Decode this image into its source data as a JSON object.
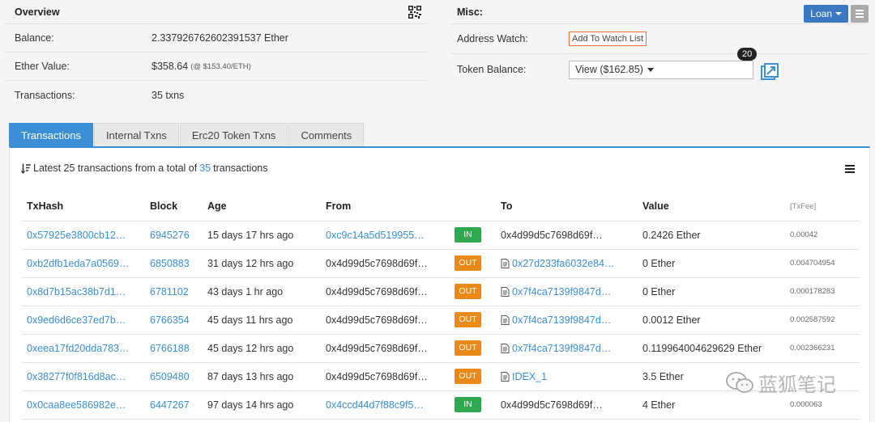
{
  "overview": {
    "title": "Overview",
    "rows": [
      {
        "label": "Balance:",
        "value": "2.337926762602391537 Ether",
        "sub": ""
      },
      {
        "label": "Ether Value:",
        "value": "$358.64",
        "sub": "(@ $153.40/ETH)"
      },
      {
        "label": "Transactions:",
        "value": "35 txns",
        "sub": ""
      }
    ]
  },
  "misc": {
    "title": "Misc:",
    "loan_label": "Loan",
    "address_watch_label": "Address Watch:",
    "watch_button": "Add To Watch List",
    "token_balance_label": "Token Balance:",
    "token_select_value": "View ($162.85)",
    "token_count_badge": "20"
  },
  "tabs": [
    {
      "label": "Transactions",
      "active": true
    },
    {
      "label": "Internal Txns",
      "active": false
    },
    {
      "label": "Erc20 Token Txns",
      "active": false
    },
    {
      "label": "Comments",
      "active": false
    }
  ],
  "summary": {
    "prefix": "Latest 25 transactions from a total of",
    "count": "35",
    "suffix": "transactions"
  },
  "table": {
    "headers": [
      "TxHash",
      "Block",
      "Age",
      "From",
      "",
      "To",
      "Value",
      "[TxFee]"
    ],
    "rows": [
      {
        "hash": "0x57925e3800cb12…",
        "block": "6945276",
        "age": "15 days 17 hrs ago",
        "from": "0xc9c14a5d519955…",
        "from_link": true,
        "dir": "IN",
        "to": "0x4d99d5c7698d69f…",
        "to_link": false,
        "to_contract": false,
        "value": "0.2426 Ether",
        "fee": "0.00042"
      },
      {
        "hash": "0xb2dfb1eda7a0569…",
        "block": "6850883",
        "age": "31 days 12 hrs ago",
        "from": "0x4d99d5c7698d69f…",
        "from_link": false,
        "dir": "OUT",
        "to": "0x27d233fa6032e84…",
        "to_link": true,
        "to_contract": true,
        "value": "0 Ether",
        "fee": "0.004704954"
      },
      {
        "hash": "0x8d7b15ac38b7d1…",
        "block": "6781102",
        "age": "43 days 1 hr ago",
        "from": "0x4d99d5c7698d69f…",
        "from_link": false,
        "dir": "OUT",
        "to": "0x7f4ca7139f9847d…",
        "to_link": true,
        "to_contract": true,
        "value": "0 Ether",
        "fee": "0.000178283"
      },
      {
        "hash": "0x9ed6d6ce37ed7b…",
        "block": "6766354",
        "age": "45 days 11 hrs ago",
        "from": "0x4d99d5c7698d69f…",
        "from_link": false,
        "dir": "OUT",
        "to": "0x7f4ca7139f9847d…",
        "to_link": true,
        "to_contract": true,
        "value": "0.0012 Ether",
        "fee": "0.002587592"
      },
      {
        "hash": "0xeea17fd20dda783…",
        "block": "6766188",
        "age": "45 days 12 hrs ago",
        "from": "0x4d99d5c7698d69f…",
        "from_link": false,
        "dir": "OUT",
        "to": "0x7f4ca7139f9847d…",
        "to_link": true,
        "to_contract": true,
        "value": "0.119964004629629 Ether",
        "fee": "0.002366231"
      },
      {
        "hash": "0x38277f0f816d8ac…",
        "block": "6509480",
        "age": "87 days 13 hrs ago",
        "from": "0x4d99d5c7698d69f…",
        "from_link": false,
        "dir": "OUT",
        "to": "IDEX_1",
        "to_link": true,
        "to_contract": true,
        "value": "3.5 Ether",
        "fee": ""
      },
      {
        "hash": "0x0caa8ee586982e…",
        "block": "6447267",
        "age": "97 days 14 hrs ago",
        "from": "0x4ccd44d7f88c9f5…",
        "from_link": true,
        "dir": "IN",
        "to": "0x4d99d5c7698d69f…",
        "to_link": false,
        "to_contract": false,
        "value": "4 Ether",
        "fee": "0.000063"
      }
    ]
  },
  "watermark": "蓝狐笔记",
  "colors": {
    "accent": "#3a8fd6",
    "in": "#2fa84f",
    "out": "#e98a18",
    "watch_border": "#e8743b"
  }
}
